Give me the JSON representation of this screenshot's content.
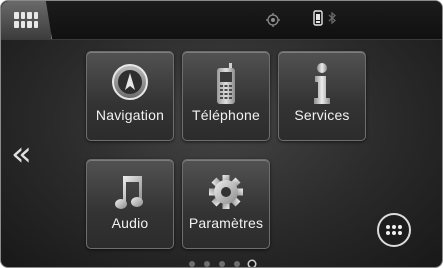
{
  "status_bar": {
    "home_icon": "home-grid-icon",
    "gps_icon": "gps-signal-icon",
    "phone_battery_icon": "phone-battery-icon",
    "bluetooth_icon": "bluetooth-icon"
  },
  "tiles": [
    {
      "label": "Navigation",
      "icon": "navigation-icon"
    },
    {
      "label": "Téléphone",
      "icon": "phone-icon"
    },
    {
      "label": "Services",
      "icon": "info-icon"
    },
    {
      "label": "Audio",
      "icon": "music-note-icon"
    },
    {
      "label": "Paramètres",
      "icon": "gear-icon"
    }
  ],
  "back_icon": "double-chevron-left-icon",
  "apps_icon": "apps-grid-icon",
  "pager": {
    "total": 5,
    "active": 5
  },
  "colors": {
    "background": "#2a2a2a",
    "tile": "#3e3e3e",
    "text": "#f2f2f2",
    "accent": "#dcdcdc"
  }
}
